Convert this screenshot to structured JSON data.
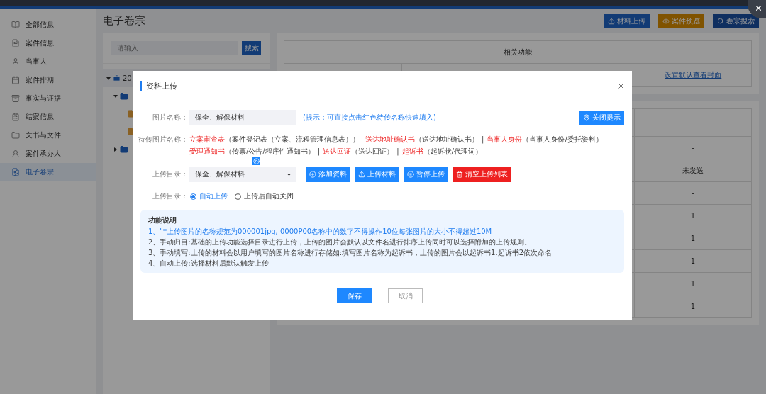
{
  "sidebar": {
    "items": [
      {
        "label": "全部信息",
        "selected": false
      },
      {
        "label": "案件信息",
        "selected": false
      },
      {
        "label": "当事人",
        "selected": false
      },
      {
        "label": "案件排期",
        "selected": false
      },
      {
        "label": "事实与证据",
        "selected": false
      },
      {
        "label": "结案信息",
        "selected": false
      },
      {
        "label": "文书与文件",
        "selected": false
      },
      {
        "label": "案件承办人",
        "selected": false
      },
      {
        "label": "电子卷宗",
        "selected": true
      }
    ]
  },
  "page": {
    "title": "电子卷宗",
    "actions": [
      {
        "label": "材料上传",
        "kind": "upload"
      },
      {
        "label": "案件预览",
        "kind": "preview"
      },
      {
        "label": "卷宗搜索",
        "kind": "search"
      }
    ]
  },
  "tree_panel": {
    "search": {
      "placeholder": "请输入"
    },
    "search_button": "搜索",
    "tree": [
      {
        "kind": "case",
        "label": "20",
        "expanded": true,
        "children": [
          {
            "kind": "folder",
            "expanded": true,
            "children": [
              {
                "kind": "file"
              },
              {
                "kind": "file"
              }
            ]
          },
          {
            "kind": "folder",
            "expanded": false
          }
        ]
      }
    ]
  },
  "related_table": {
    "title": "相关功能",
    "link": "设置默认查看封面"
  },
  "status_table": {
    "rows": [
      {
        "last_cell": "-"
      },
      {
        "last_cell": "未发送"
      },
      {
        "last_cell": "-"
      },
      {
        "last_cell": "1"
      },
      {
        "last_cell": "1"
      },
      {
        "last_cell": "1"
      },
      {
        "last_cell": "1"
      },
      {
        "last_cell": "1"
      }
    ]
  },
  "dialog": {
    "title": "资料上传",
    "image_name": {
      "label": "图片名称：",
      "value": "保全、解保材料",
      "hint": "(提示：可直接点击红色待传名称快速填入)",
      "button": "关闭提示"
    },
    "pending": {
      "label": "待传图片名称：",
      "lines": [
        [
          {
            "name": "立案审查表",
            "note": "（案件登记表（立案、流程管理信息表））"
          },
          {
            "name": "送达地址确认书",
            "note": "（送达地址确认书）",
            "separator": "|"
          },
          {
            "name": "当事人身份",
            "note": "（当事人身份/委托资料）"
          }
        ],
        [
          {
            "name": "受理通知书",
            "note": "（传票/公告/程序性通知书）",
            "separator": "|"
          },
          {
            "name": "送达回证",
            "note": "（送达回证）",
            "separator": "|"
          },
          {
            "name": "起诉书",
            "note": "（起诉状/代理词）"
          }
        ]
      ]
    },
    "directory": {
      "label": "上传目录：",
      "value": "保全、解保材料",
      "buttons": [
        {
          "label": "添加资料",
          "kind": "add"
        },
        {
          "label": "上传材料",
          "kind": "upload"
        },
        {
          "label": "暂停上传",
          "kind": "pause"
        },
        {
          "label": "清空上传列表",
          "kind": "clear"
        }
      ]
    },
    "mode": {
      "label": "上传目录：",
      "options": [
        {
          "label": "自动上传",
          "selected": true
        },
        {
          "label": "上传后自动关闭",
          "selected": false
        }
      ]
    },
    "info": {
      "title": "功能说明",
      "lines": [
        {
          "text": "1、\"*上传图片的名称规范为000001jpg, 0000P00名称中的数字不得操作10位每张图片的大小不得超过10M",
          "highlight": true
        },
        {
          "text": "2、手动归目:基础的上传功能选择目录进行上传，上传的图片会默认以文件名进行排序上传同时可以选择附加的上传规则。",
          "highlight": false
        },
        {
          "text": "3、手动填写:上传的材料会以用户填写的图片名称进行存储如:填写图片名称为起诉书，上传的图片会以起诉书1.起诉书2依次命名",
          "highlight": false
        },
        {
          "text": "4、自动上传:选择材料后默认触发上传",
          "highlight": false
        }
      ]
    },
    "footer": {
      "save": "保存",
      "cancel": "取消"
    }
  }
}
